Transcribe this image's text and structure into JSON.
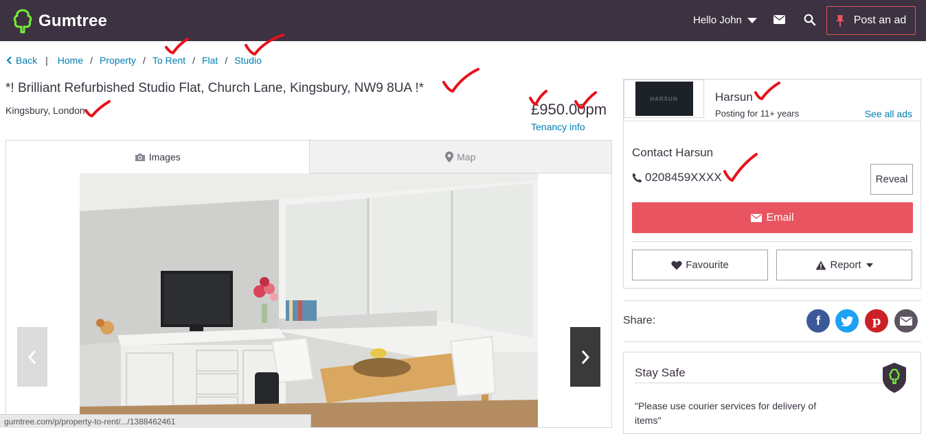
{
  "header": {
    "brand": "Gumtree",
    "greeting": "Hello John",
    "post_ad_label": "Post an ad"
  },
  "breadcrumb": {
    "back": "Back",
    "items": [
      "Home",
      "Property",
      "To Rent",
      "Flat",
      "Studio"
    ]
  },
  "listing": {
    "title": "*! Brilliant Refurbished Studio Flat, Church Lane, Kingsbury, NW9 8UA !*",
    "location": "Kingsbury, London",
    "price": "£950.00pm",
    "tenancy_link": "Tenancy info"
  },
  "gallery": {
    "tab_images": "Images",
    "tab_map": "Map",
    "active_tab": "Images"
  },
  "seller": {
    "logo_text": "HARSUN",
    "name": "Harsun",
    "posting_for": "Posting for 11+ years",
    "see_all": "See all ads",
    "contact_title": "Contact Harsun",
    "phone": "0208459XXXX",
    "reveal_label": "Reveal",
    "email_label": "Email",
    "favourite_label": "Favourite",
    "report_label": "Report"
  },
  "share": {
    "label": "Share:",
    "networks": [
      "facebook",
      "twitter",
      "pinterest",
      "email"
    ]
  },
  "safety": {
    "title": "Stay Safe",
    "tip": "\"Please use courier services for delivery of items\""
  },
  "status_bar": {
    "url": "gumtree.com/p/property-to-rent/.../1388462461"
  },
  "colors": {
    "header_bg": "#3c3241",
    "accent": "#e85560",
    "link": "#007fb0",
    "brand_green": "#72ef36",
    "annotation_red": "#e8101a"
  },
  "icons": [
    "gumtree-tree-icon",
    "caret-down-icon",
    "mail-icon",
    "search-icon",
    "pin-icon",
    "chevron-left-icon",
    "camera-icon",
    "map-marker-icon",
    "chevron-right-icon",
    "phone-icon",
    "envelope-icon",
    "heart-icon",
    "warning-icon",
    "facebook-icon",
    "twitter-icon",
    "pinterest-icon",
    "email-share-icon",
    "shield-icon"
  ]
}
